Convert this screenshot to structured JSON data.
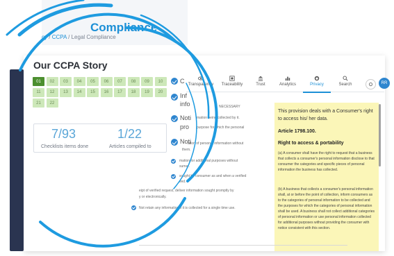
{
  "header": {
    "title": "Compliance",
    "breadcrumb": [
      {
        "label": "cy"
      },
      {
        "label": "CCPA"
      },
      {
        "label": "Legal Compliance"
      }
    ],
    "separator": "/"
  },
  "story": {
    "title": "Our CCPA Story",
    "cells": [
      "01",
      "02",
      "03",
      "04",
      "05",
      "06",
      "07",
      "08",
      "09",
      "10",
      "11",
      "12",
      "13",
      "14",
      "15",
      "16",
      "17",
      "18",
      "19",
      "20",
      "21",
      "22"
    ],
    "active_cell": "01",
    "stats": [
      {
        "value": "7/93",
        "label": "Checklists items done"
      },
      {
        "value": "1/22",
        "label": "Articles compiled to"
      }
    ]
  },
  "tabs": [
    {
      "label": "Transparency",
      "icon": "eye-icon"
    },
    {
      "label": "Traceability",
      "icon": "target-icon"
    },
    {
      "label": "Trust",
      "icon": "bank-icon"
    },
    {
      "label": "Analytics",
      "icon": "bar-chart-icon"
    },
    {
      "label": "Privacy",
      "icon": "globe-shield-icon",
      "active": true
    },
    {
      "label": "Search",
      "icon": "search-icon"
    }
  ],
  "avatar": "RR",
  "checklist_big": [
    {
      "text": "C"
    },
    {
      "text": "Inf"
    },
    {
      "text": "info"
    },
    {
      "text": "Noti"
    },
    {
      "text": "pro"
    },
    {
      "text": "Noti"
    }
  ],
  "checklist_small": [
    {
      "text": "NECESSARY"
    },
    {
      "text": "mation being collected by it."
    },
    {
      "text": "purpose for which the personal"
    },
    {
      "text": "ation of personal information without"
    },
    {
      "text": "them."
    },
    {
      "text": "mation for additional purposes without"
    },
    {
      "text": "sumer."
    },
    {
      "text": "sought by consumer as and when a verified"
    },
    {
      "text": "ved."
    },
    {
      "text": "eipt of verified request, deliver information sought promptly by"
    },
    {
      "text": "y or electronically."
    },
    {
      "text": "Not retain any information if it is collected for a single time use."
    }
  ],
  "law": {
    "description": "This provision deals with a Consumer's right to access his/ her data.",
    "article": "Article 1798.100.",
    "right": "Right to access & portability",
    "para_a": "(a) A consumer shall have the right to request that a business that collects a consumer's personal information disclose to that consumer the categories and specific pieces of personal information the business has collected.",
    "para_b": "(b) A business that collects a consumer's personal information shall, at or before the point of collection, inform consumers as to the categories of personal information to be collected and the purposes for which the categories of personal information shall be used. A business shall not collect additional categories of personal information or use personal information collected for additional purposes without providing the consumer with notice consistent with this section."
  },
  "colors": {
    "accent": "#1c8fd6",
    "ring": "#1e9be0",
    "cell": "#cde8b9",
    "cell_active": "#4c8f2f",
    "law_bg": "#fbf6b8",
    "sidebar": "#2a3450"
  }
}
